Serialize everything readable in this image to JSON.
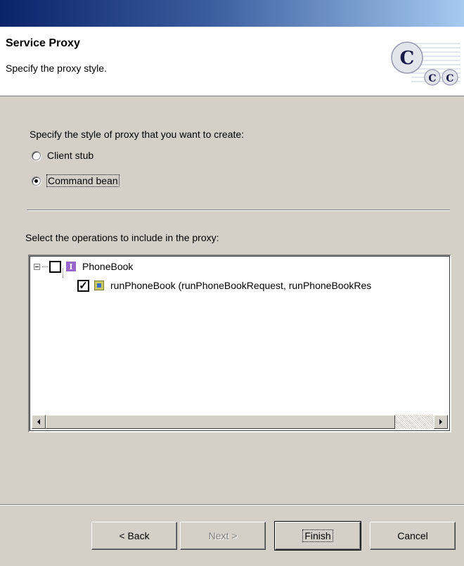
{
  "banner": {
    "title": "Service Proxy",
    "description": "Specify the proxy style.",
    "logo_icon": "ccc-logo-icon"
  },
  "style_section": {
    "prompt": "Specify the style of proxy that you want to create:",
    "options": [
      {
        "label": "Client stub",
        "checked": false
      },
      {
        "label": "Command bean",
        "checked": true
      }
    ]
  },
  "operations_section": {
    "prompt": "Select the operations to include in the proxy:",
    "tree": [
      {
        "label": "PhoneBook",
        "icon": "interface-icon",
        "checked": false,
        "expanded": true
      },
      {
        "label": "runPhoneBook (runPhoneBookRequest, runPhoneBookRes",
        "icon": "operation-icon",
        "checked": true
      }
    ]
  },
  "buttons": {
    "back": "< Back",
    "next": "Next >",
    "finish": "Finish",
    "cancel": "Cancel"
  }
}
